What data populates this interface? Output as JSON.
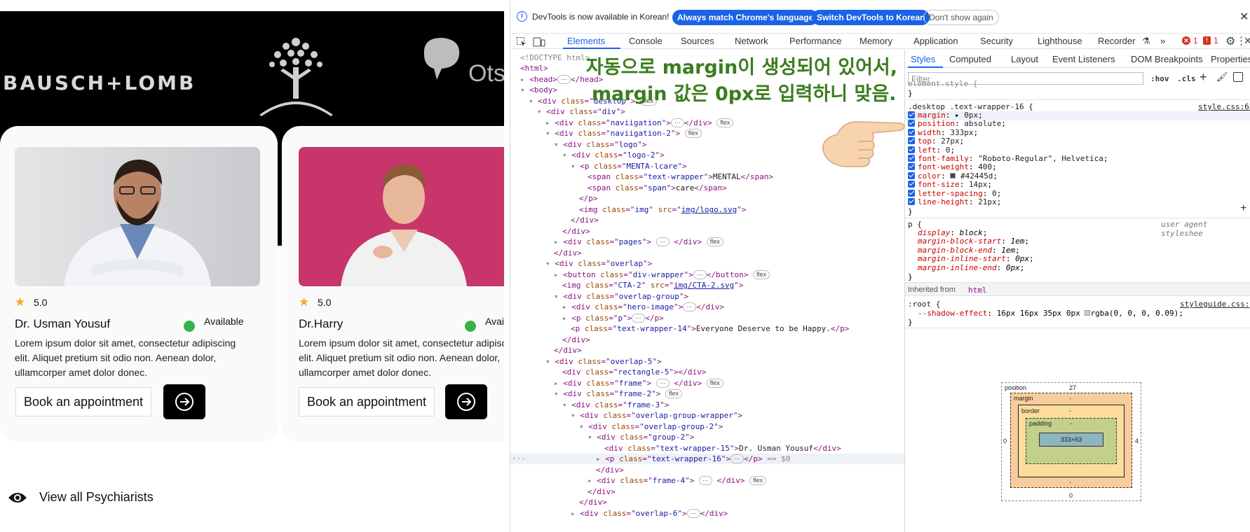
{
  "page": {
    "logos": {
      "brand1": "BAUSCH+LOMB",
      "brand3_partial": "Ots"
    },
    "cards": [
      {
        "rating": "5.0",
        "name": "Dr. Usman Yousuf",
        "status": "Available",
        "description": [
          "Lorem ipsum dolor sit amet, consectetur adipiscing",
          "elit. Aliquet pretium sit odio non. Aenean dolor,",
          "ullamcorper amet dolor donec."
        ],
        "book_label": "Book an appointment"
      },
      {
        "rating": "5.0",
        "name": "Dr.Harry",
        "status": "Avai",
        "description": [
          "Lorem ipsum dolor sit amet, consectetur adipisc",
          "elit. Aliquet pretium sit odio non. Aenean dolor,",
          "ullamcorper amet dolor donec."
        ],
        "book_label": "Book an appointment"
      }
    ],
    "view_all": "View all Psychiarists"
  },
  "devtools": {
    "infobar": {
      "message": "DevTools is now available in Korean!",
      "btn_match": "Always match Chrome's language",
      "btn_switch": "Switch DevTools to Korean",
      "btn_dismiss": "Don't show again"
    },
    "tabs": [
      "Elements",
      "Console",
      "Sources",
      "Network",
      "Performance",
      "Memory",
      "Application",
      "Security",
      "Lighthouse",
      "Recorder"
    ],
    "more": "»",
    "errors": "1",
    "warnings": "1",
    "dom": {
      "l0": "<!DOCTYPE html>",
      "l1": "<html>",
      "l2a": "<head>",
      "l2b": "</head>",
      "l3": "<body>",
      "desktop": "desktop",
      "div": "div",
      "nav": "naviigation",
      "nav2": "naviigation-2",
      "logo": "logo",
      "logo2": "logo-2",
      "mental": "MENTA-lcare",
      "tw": "text-wrapper",
      "twtext": "MENTAL",
      "span": "span",
      "spantext": "care",
      "img": "img",
      "imgsrc": "img/logo.svg",
      "pages": "pages",
      "overlap": "overlap",
      "divwrapper": "div-wrapper",
      "cta": "CTA-2",
      "ctasrc": "img/CTA-2.svg",
      "og": "overlap-group",
      "hero": "hero-image",
      "p": "p",
      "tw14": "text-wrapper-14",
      "tw14text": "Everyone Deserve to be Happy.",
      "ov5": "overlap-5",
      "rect5": "rectangle-5",
      "frame": "frame",
      "frame2": "frame-2",
      "frame3": "frame-3",
      "ogw": "overlap-group-wrapper",
      "og2": "overlap-group-2",
      "group2": "group-2",
      "tw15": "text-wrapper-15",
      "tw15text": "Dr. Usman Yousuf",
      "tw16": "text-wrapper-16",
      "sel": " == $0",
      "frame4": "frame-4",
      "ov6": "overlap-6",
      "flex": "flex"
    },
    "styles": {
      "tabs": [
        "Styles",
        "Computed",
        "Layout",
        "Event Listeners",
        "DOM Breakpoints",
        "Properties"
      ],
      "filter_placeholder": "Filter",
      "hov": ":hov",
      "cls": ".cls",
      "element_style": "element.style {",
      "close": "}",
      "rule_selector": ".desktop .text-wrapper-16 {",
      "rule_source": "style.css:62",
      "props": [
        [
          "margin",
          "0px"
        ],
        [
          "position",
          "absolute"
        ],
        [
          "width",
          "333px"
        ],
        [
          "top",
          "27px"
        ],
        [
          "left",
          "0"
        ],
        [
          "font-family",
          "\"Roboto-Regular\", Helvetica"
        ],
        [
          "font-weight",
          "400"
        ],
        [
          "color",
          "#42445d"
        ],
        [
          "font-size",
          "14px"
        ],
        [
          "letter-spacing",
          "0"
        ],
        [
          "line-height",
          "21px"
        ]
      ],
      "ua_selector": "p {",
      "ua_source": "user agent styleshee",
      "ua_props": [
        [
          "display",
          "block"
        ],
        [
          "margin-block-start",
          "1em"
        ],
        [
          "margin-block-end",
          "1em"
        ],
        [
          "margin-inline-start",
          "0px"
        ],
        [
          "margin-inline-end",
          "0px"
        ]
      ],
      "inherited": "Inherited from",
      "inherited_tag": "html",
      "root_selector": ":root {",
      "root_source": "styleguide.css:",
      "root_prop": "--shadow-effect",
      "root_val": "16px 16px 35px 0px",
      "root_val2": "rgba(0, 0, 0, 0.09);",
      "box": {
        "position": "position",
        "pos_top": "27",
        "pos_left": "0",
        "pos_right": "4",
        "pos_bottom": "0",
        "margin": "margin",
        "border": "border",
        "padding": "padding",
        "dash": "-",
        "content": "333×63"
      }
    },
    "annotation": [
      "자동으로 margin이 생성되어 있어서,",
      "margin 값은 0px로 입력하니 맞음."
    ],
    "colors": {
      "accent": "#1a62e8",
      "annotation": "#3b7d1e"
    }
  }
}
